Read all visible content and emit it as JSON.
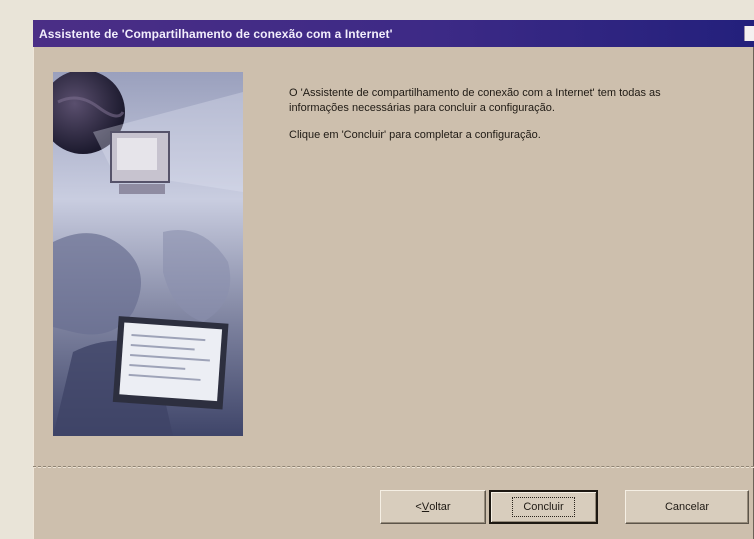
{
  "window": {
    "title": "Assistente de 'Compartilhamento de conexão com a Internet'"
  },
  "content": {
    "paragraph1": "O 'Assistente de compartilhamento de conexão com a Internet' tem todas as informações necessárias para concluir a configuração.",
    "paragraph2": "Clique em 'Concluir' para completar a configuração."
  },
  "buttons": {
    "back_prefix": "< ",
    "back_accel": "V",
    "back_rest": "oltar",
    "finish": "Concluir",
    "cancel": "Cancelar"
  }
}
